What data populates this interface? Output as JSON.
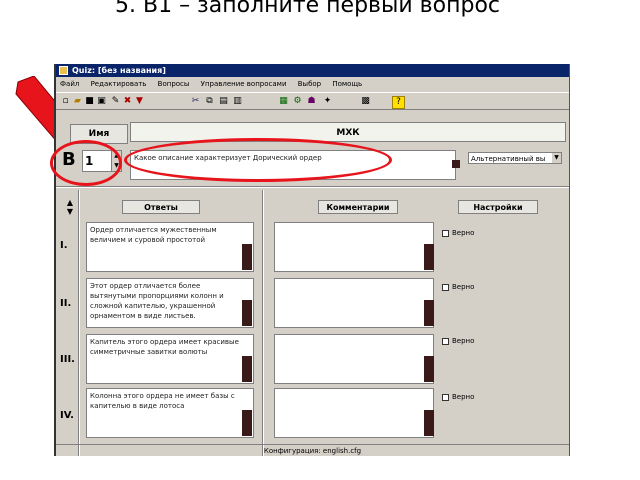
{
  "slide": {
    "title": "5. В1 – заполните первый вопрос"
  },
  "window": {
    "title": "Quiz: [без названия]"
  },
  "menu": [
    "Файл",
    "Редактировать",
    "Вопросы",
    "Управление вопросами",
    "Выбор",
    "Помощь"
  ],
  "toolbar_icons": [
    "new-icon",
    "open-icon",
    "save-icon",
    "save-as-icon",
    "check-icon",
    "delete-icon",
    "down-icon",
    "cut-icon",
    "copy-icon",
    "paste-icon",
    "print-icon",
    "test-icon",
    "settings-icon",
    "users-icon",
    "run-icon",
    "help-icon"
  ],
  "header": {
    "name_label": "Имя",
    "name_value": "МХК"
  },
  "question": {
    "letter": "В",
    "number": "1",
    "text": "Какое описание характеризует Дорический ордер",
    "type": "Альтернативный вы"
  },
  "columns": {
    "answers": "Ответы",
    "comments": "Комментарии",
    "settings": "Настройки"
  },
  "answers": [
    {
      "num": "I.",
      "text": "Ордер отличается мужественным величием и суровой простотой",
      "check": "Верно"
    },
    {
      "num": "II.",
      "text": "Этот ордер отличается более вытянутыми пропорциями колонн и сложной капителью, украшенной орнаментом в виде листьев.",
      "check": "Верно"
    },
    {
      "num": "III.",
      "text": "Капитель этого ордера имеет красивые симметричные завитки волюты",
      "check": "Верно"
    },
    {
      "num": "IV.",
      "text": "Колонна этого ордера не имеет базы с капителью в виде лотоса",
      "check": "Верно"
    }
  ],
  "status": "Конфигурация: english.cfg",
  "colors": {
    "annotation": "#e8141c",
    "titlebar": "#0a246a"
  }
}
